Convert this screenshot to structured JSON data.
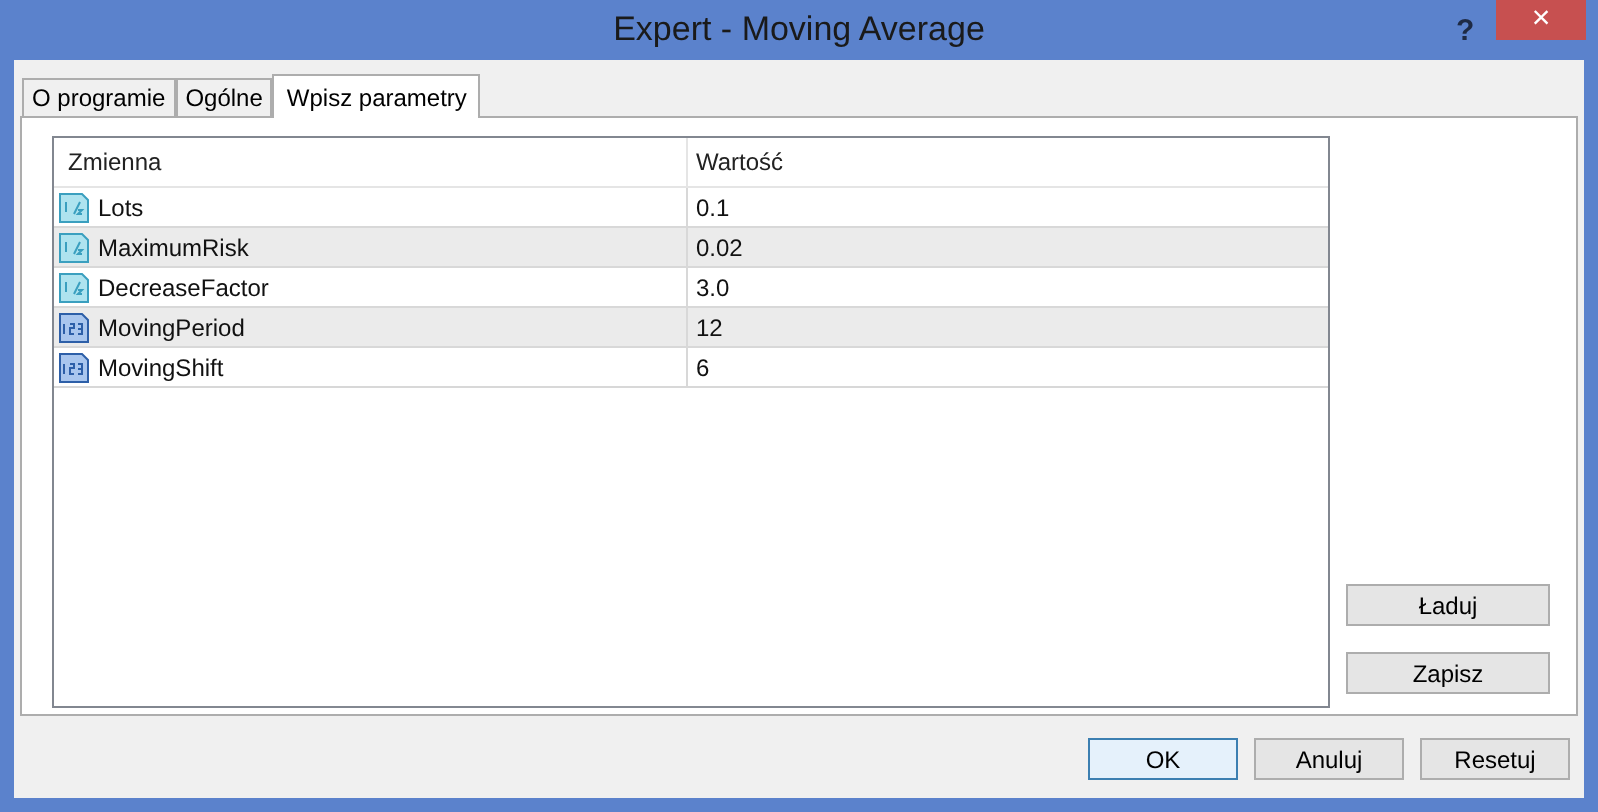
{
  "window": {
    "title": "Expert - Moving Average",
    "help": "?",
    "close": "×"
  },
  "tabs": [
    {
      "label": "O programie",
      "selected": false
    },
    {
      "label": "Ogólne",
      "selected": false
    },
    {
      "label": "Wpisz parametry",
      "selected": true
    }
  ],
  "table": {
    "columns": [
      "Zmienna",
      "Wartość"
    ],
    "rows": [
      {
        "kind": "double",
        "name": "Lots",
        "value": "0.1"
      },
      {
        "kind": "double",
        "name": "MaximumRisk",
        "value": "0.02"
      },
      {
        "kind": "double",
        "name": "DecreaseFactor",
        "value": "3.0"
      },
      {
        "kind": "int",
        "name": "MovingPeriod",
        "value": "12"
      },
      {
        "kind": "int",
        "name": "MovingShift",
        "value": "6"
      }
    ]
  },
  "side_buttons": [
    "Ładuj",
    "Zapisz"
  ],
  "buttons": [
    {
      "label": "OK",
      "default": true
    },
    {
      "label": "Anuluj",
      "default": false
    },
    {
      "label": "Resetuj",
      "default": false
    }
  ]
}
